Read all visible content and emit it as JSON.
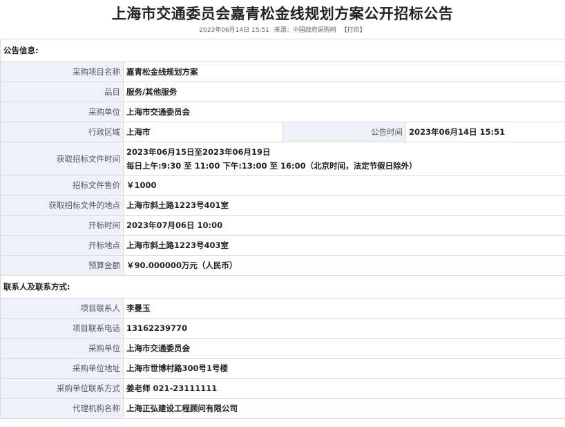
{
  "header": {
    "title": "上海市交通委员会嘉青松金线规划方案公开招标公告",
    "date": "2023年06月14日 15:51",
    "source": "来源：中国政府采购网",
    "print": "【打印】"
  },
  "sections": {
    "announcement": "公告信息:",
    "contacts": "联系人及联系方式:"
  },
  "announcement": {
    "project_name_label": "采购项目名称",
    "project_name": "嘉青松金线规划方案",
    "category_label": "品目",
    "category": "服务/其他服务",
    "purchaser_label": "采购单位",
    "purchaser": "上海市交通委员会",
    "region_label": "行政区域",
    "region": "上海市",
    "announce_time_label": "公告时间",
    "announce_time": "2023年06月14日 15:51",
    "doc_time_label": "获取招标文件时间",
    "doc_time_line1": "2023年06月15日至2023年06月19日",
    "doc_time_line2": "每日上午:9:30 至 11:00  下午:13:00 至 16:00（北京时间，法定节假日除外）",
    "doc_price_label": "招标文件售价",
    "doc_price": "￥1000",
    "doc_place_label": "获取招标文件的地点",
    "doc_place": "上海市斜土路1223号401室",
    "open_time_label": "开标时间",
    "open_time": "2023年07月06日 10:00",
    "open_place_label": "开标地点",
    "open_place": "上海市斜土路1223号403室",
    "budget_label": "预算金额",
    "budget": "￥90.000000万元（人民币）"
  },
  "contacts": {
    "contact_label": "项目联系人",
    "contact": "李曼玉",
    "phone_label": "项目联系电话",
    "phone": "13162239770",
    "purchaser_label": "采购单位",
    "purchaser": "上海市交通委员会",
    "purchaser_addr_label": "采购单位地址",
    "purchaser_addr": "上海市世博村路300号1号楼",
    "purchaser_contact_label": "采购单位联系方式",
    "purchaser_contact": "姜老师 021-23111111",
    "agency_label": "代理机构名称",
    "agency": "上海正弘建设工程顾问有限公司"
  }
}
